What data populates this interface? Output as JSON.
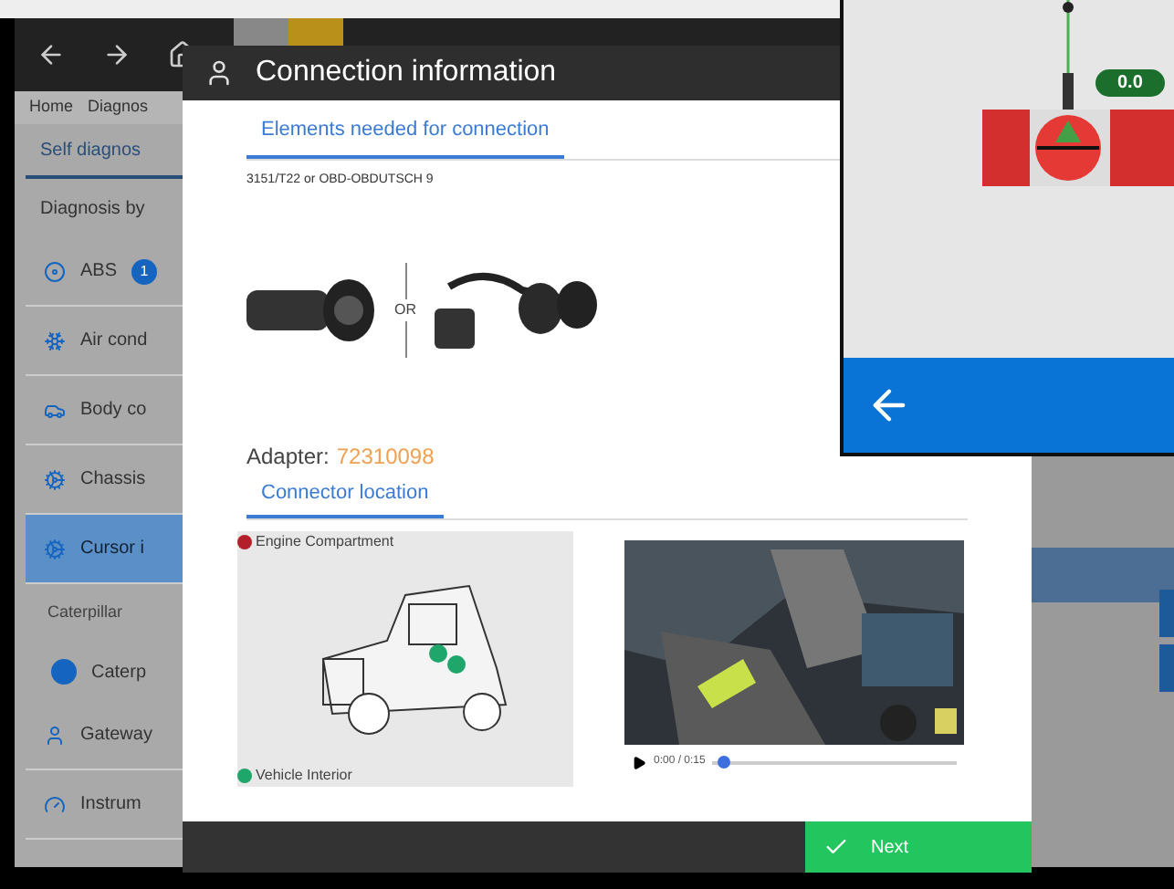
{
  "background_app": {
    "nav": [
      "Home",
      "Diagnos"
    ],
    "tabs": [
      {
        "label": "Self diagnos",
        "selected": true
      }
    ],
    "section_title": "Diagnosis by",
    "items": [
      {
        "label": "ABS",
        "badge": "1",
        "selected": false,
        "kind": "item"
      },
      {
        "label": "Air cond",
        "selected": false,
        "kind": "item"
      },
      {
        "label": "Body co",
        "selected": false,
        "kind": "item"
      },
      {
        "label": "Chassis",
        "selected": false,
        "kind": "item"
      },
      {
        "label": "Cursor i",
        "selected": true,
        "kind": "item"
      },
      {
        "label": "Caterpillar",
        "kind": "subheader"
      },
      {
        "label": "Caterp",
        "kind": "radio",
        "selected": true
      },
      {
        "label": "Gateway",
        "selected": false,
        "kind": "item"
      },
      {
        "label": "Instrum",
        "selected": false,
        "kind": "item"
      }
    ]
  },
  "dialog": {
    "title": "Connection information",
    "elements_tab": {
      "label": "Elements needed for connection",
      "selected": true
    },
    "cable_text": "3151/T22 or OBD-OBDUTSCH 9",
    "or_text": "OR",
    "adapter_label": "Adapter:",
    "adapter_value": "72310098",
    "location_tab": {
      "label": "Connector location",
      "selected": true
    },
    "locations": [
      {
        "label": "Engine Compartment",
        "color": "#b3202a"
      },
      {
        "label": "Vehicle Interior",
        "color": "#1fa66a"
      }
    ],
    "video": {
      "time": "0:00 / 0:15",
      "level": 0.02
    },
    "next_button": "Next"
  },
  "alignment_window": {
    "reading": "0.0"
  }
}
